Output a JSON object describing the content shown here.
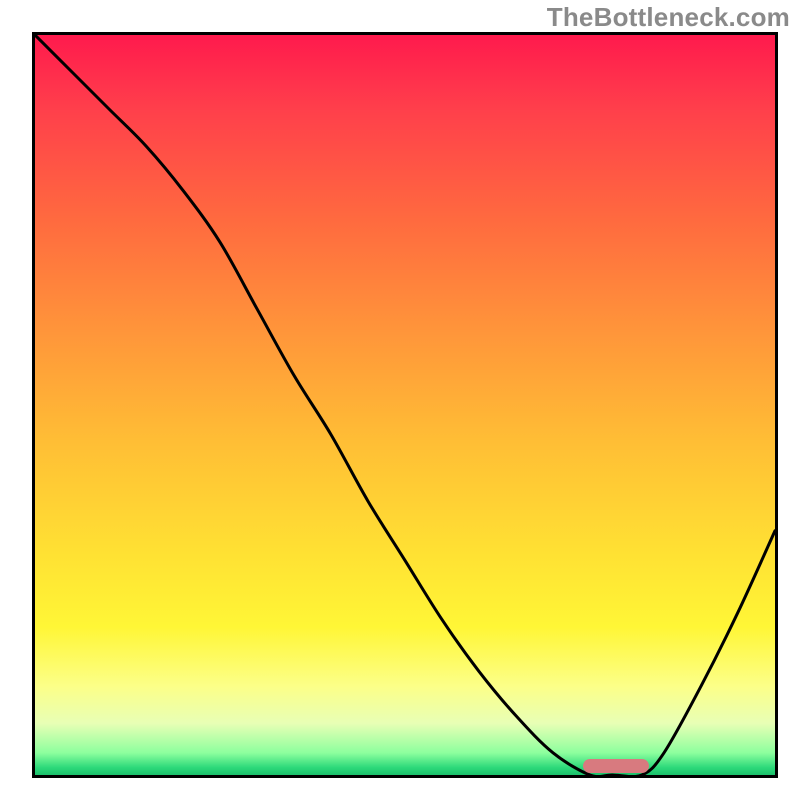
{
  "watermark": {
    "text": "TheBottleneck.com"
  },
  "chart_data": {
    "type": "line",
    "title": "",
    "xlabel": "",
    "ylabel": "",
    "x": [
      0.0,
      0.05,
      0.1,
      0.15,
      0.2,
      0.25,
      0.3,
      0.35,
      0.4,
      0.45,
      0.5,
      0.55,
      0.6,
      0.65,
      0.7,
      0.75,
      0.78,
      0.82,
      0.85,
      0.9,
      0.95,
      1.0
    ],
    "values": [
      1.0,
      0.95,
      0.9,
      0.85,
      0.79,
      0.72,
      0.63,
      0.54,
      0.46,
      0.37,
      0.29,
      0.21,
      0.14,
      0.08,
      0.03,
      0.0,
      0.0,
      0.0,
      0.03,
      0.12,
      0.22,
      0.33
    ],
    "xlim": [
      0,
      1
    ],
    "ylim": [
      0,
      1
    ],
    "optimum_range_x": [
      0.74,
      0.83
    ],
    "bg_gradient_stops": [
      {
        "pct": 0,
        "color": "#ff1a4d"
      },
      {
        "pct": 10,
        "color": "#ff3f4b"
      },
      {
        "pct": 25,
        "color": "#ff6a3f"
      },
      {
        "pct": 40,
        "color": "#ff953a"
      },
      {
        "pct": 55,
        "color": "#ffbe35"
      },
      {
        "pct": 70,
        "color": "#ffe133"
      },
      {
        "pct": 80,
        "color": "#fff636"
      },
      {
        "pct": 88,
        "color": "#fcff88"
      },
      {
        "pct": 93,
        "color": "#e8ffb5"
      },
      {
        "pct": 97,
        "color": "#8dff9e"
      },
      {
        "pct": 99,
        "color": "#2cd97a"
      },
      {
        "pct": 100,
        "color": "#1bc06b"
      }
    ],
    "marker_color": "#d87a7f"
  }
}
